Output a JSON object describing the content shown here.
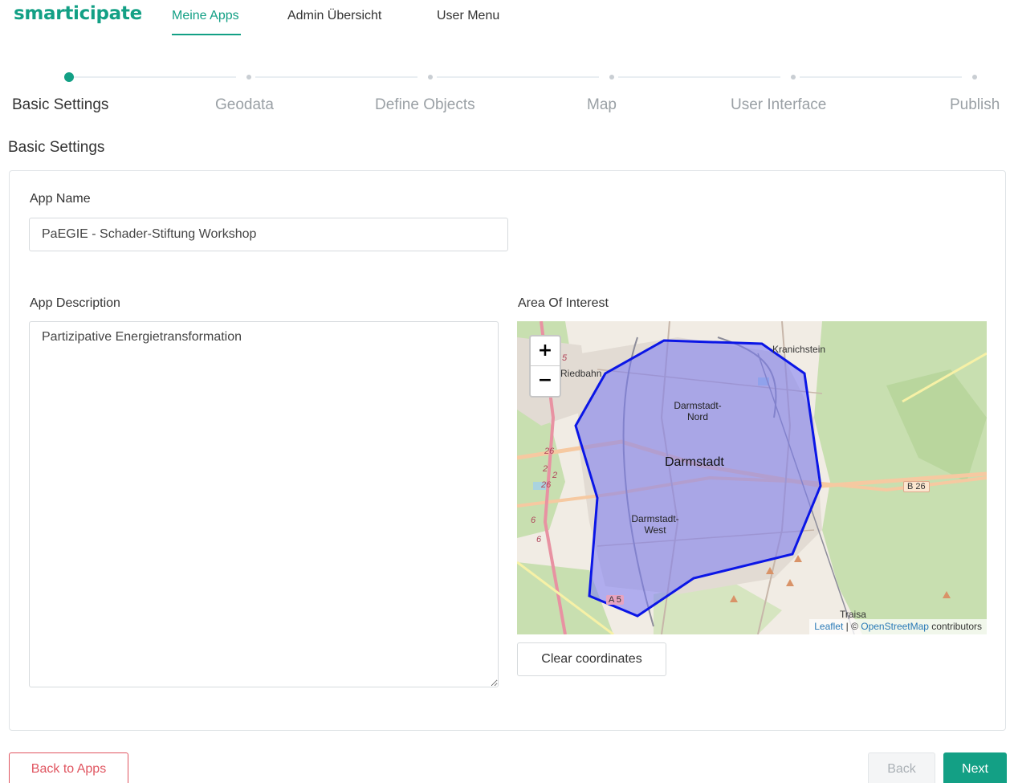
{
  "nav": {
    "brand": "smarticipate",
    "links": [
      {
        "label": "Meine Apps",
        "active": true
      },
      {
        "label": "Admin Übersicht",
        "active": false
      },
      {
        "label": "User Menu",
        "active": false
      }
    ]
  },
  "stepper": {
    "steps": [
      {
        "label": "Basic Settings",
        "active": true
      },
      {
        "label": "Geodata",
        "active": false
      },
      {
        "label": "Define Objects",
        "active": false
      },
      {
        "label": "Map",
        "active": false
      },
      {
        "label": "User Interface",
        "active": false
      },
      {
        "label": "Publish",
        "active": false
      }
    ]
  },
  "section_title": "Basic Settings",
  "form": {
    "app_name_label": "App Name",
    "app_name_value": "PaEGIE - Schader-Stiftung Workshop",
    "app_description_label": "App Description",
    "app_description_value": "Partizipative Energietransformation",
    "area_label": "Area Of Interest",
    "clear_label": "Clear coordinates"
  },
  "map": {
    "zoom_in": "+",
    "zoom_out": "−",
    "labels": {
      "kranichstein": "Kranichstein",
      "riedbahn": "Riedbahn",
      "nord_1": "Darmstadt-",
      "nord_2": "Nord",
      "city": "Darmstadt",
      "west_1": "Darmstadt-",
      "west_2": "West",
      "traisa": "Traisa",
      "b26": "B 26",
      "a5": "A 5",
      "r5": "5",
      "r26a": "26",
      "r2": "2",
      "r2b": "2",
      "r26b": "26",
      "r6": "6",
      "r6b": "6"
    },
    "attribution": {
      "leaflet": "Leaflet",
      "sep": " | © ",
      "osm": "OpenStreetMap",
      "suffix": " contributors"
    },
    "colors": {
      "forest": "#c8dfb0",
      "urban": "#e2dbd3",
      "polygon_fill": "#7a7af5",
      "polygon_stroke": "#0b16e6",
      "major_road": "#f6c9a1",
      "motorway": "#e892a2"
    }
  },
  "footer": {
    "back_to_apps": "Back to Apps",
    "back": "Back",
    "next": "Next"
  },
  "colors": {
    "accent": "#13a085",
    "danger": "#e05560"
  }
}
